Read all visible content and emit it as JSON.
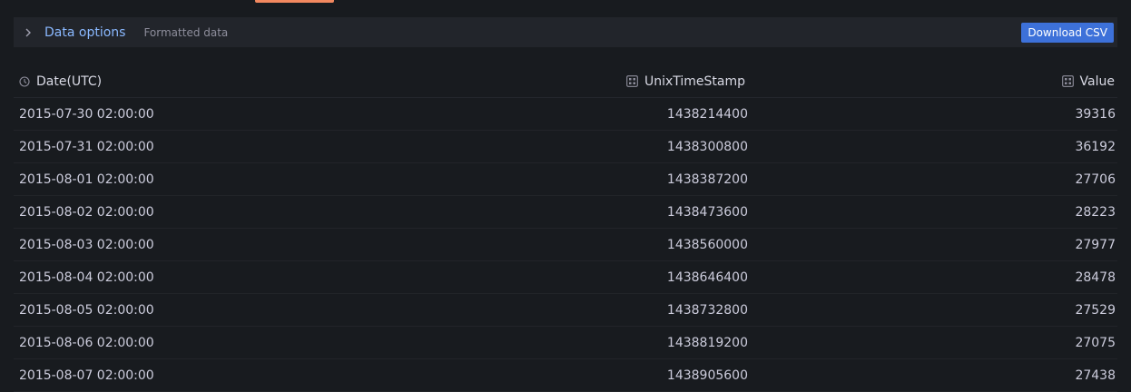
{
  "options": {
    "title": "Data options",
    "subtitle": "Formatted data",
    "download_label": "Download CSV"
  },
  "table": {
    "columns": [
      "Date(UTC)",
      "UnixTimeStamp",
      "Value"
    ],
    "rows": [
      [
        "2015-07-30 02:00:00",
        "1438214400",
        "39316"
      ],
      [
        "2015-07-31 02:00:00",
        "1438300800",
        "36192"
      ],
      [
        "2015-08-01 02:00:00",
        "1438387200",
        "27706"
      ],
      [
        "2015-08-02 02:00:00",
        "1438473600",
        "28223"
      ],
      [
        "2015-08-03 02:00:00",
        "1438560000",
        "27977"
      ],
      [
        "2015-08-04 02:00:00",
        "1438646400",
        "28478"
      ],
      [
        "2015-08-05 02:00:00",
        "1438732800",
        "27529"
      ],
      [
        "2015-08-06 02:00:00",
        "1438819200",
        "27075"
      ],
      [
        "2015-08-07 02:00:00",
        "1438905600",
        "27438"
      ]
    ]
  },
  "colors": {
    "background": "#181b1f",
    "accent_link": "#8ab8ff",
    "button": "#3d71d9",
    "tab_accent": "#f2885f"
  },
  "icons": {
    "expand": "chevron-right-icon",
    "time_column": "clock-icon",
    "number_column": "calculator-icon"
  }
}
